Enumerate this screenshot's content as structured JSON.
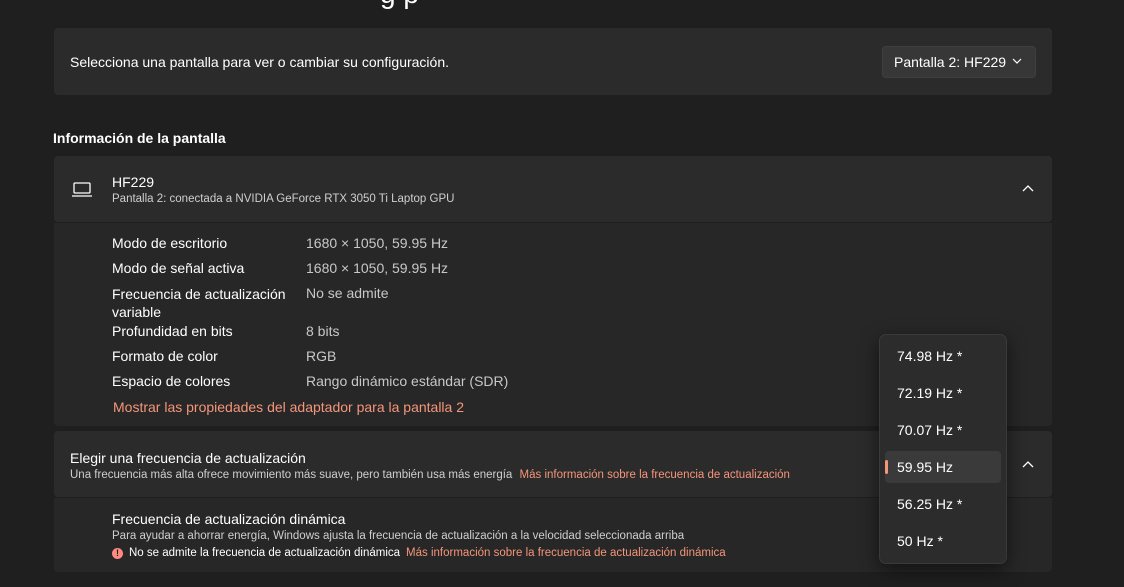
{
  "header": {
    "partial_title": "g                          p"
  },
  "display_select": {
    "prompt": "Selecciona una pantalla para ver o cambiar su configuración.",
    "selected": "Pantalla 2: HF229"
  },
  "display_info": {
    "section_title": "Información de la pantalla",
    "monitor_name": "HF229",
    "monitor_subtitle": "Pantalla 2: conectada a NVIDIA GeForce RTX 3050 Ti Laptop GPU",
    "rows": [
      {
        "label": "Modo de escritorio",
        "value": "1680 × 1050, 59.95 Hz"
      },
      {
        "label": "Modo de señal activa",
        "value": "1680 × 1050, 59.95 Hz"
      },
      {
        "label": "Frecuencia de actualización variable",
        "value": "No se admite"
      },
      {
        "label": "Profundidad en bits",
        "value": "8 bits"
      },
      {
        "label": "Formato de color",
        "value": "RGB"
      },
      {
        "label": "Espacio de colores",
        "value": "Rango dinámico estándar (SDR)"
      }
    ],
    "adapter_link": "Mostrar las propiedades del adaptador para la pantalla 2"
  },
  "refresh_rate": {
    "title": "Elegir una frecuencia de actualización",
    "subtitle": "Una frecuencia más alta ofrece movimiento más suave, pero también usa más energía",
    "more_info_link": "Más información sobre la frecuencia de actualización",
    "options": [
      "74.98 Hz *",
      "72.19 Hz *",
      "70.07 Hz *",
      "59.95 Hz",
      "56.25 Hz *",
      "50 Hz *"
    ],
    "selected_index": 3
  },
  "dynamic_refresh": {
    "title": "Frecuencia de actualización dinámica",
    "subtitle": "Para ayudar a ahorrar energía, Windows ajusta la frecuencia de actualización a la velocidad seleccionada arriba",
    "warning": "No se admite la frecuencia de actualización dinámica",
    "warning_link": "Más información sobre la frecuencia de actualización dinámica"
  },
  "colors": {
    "accent": "#f5957a",
    "background": "#1f1f1f",
    "card": "#2b2b2b"
  }
}
